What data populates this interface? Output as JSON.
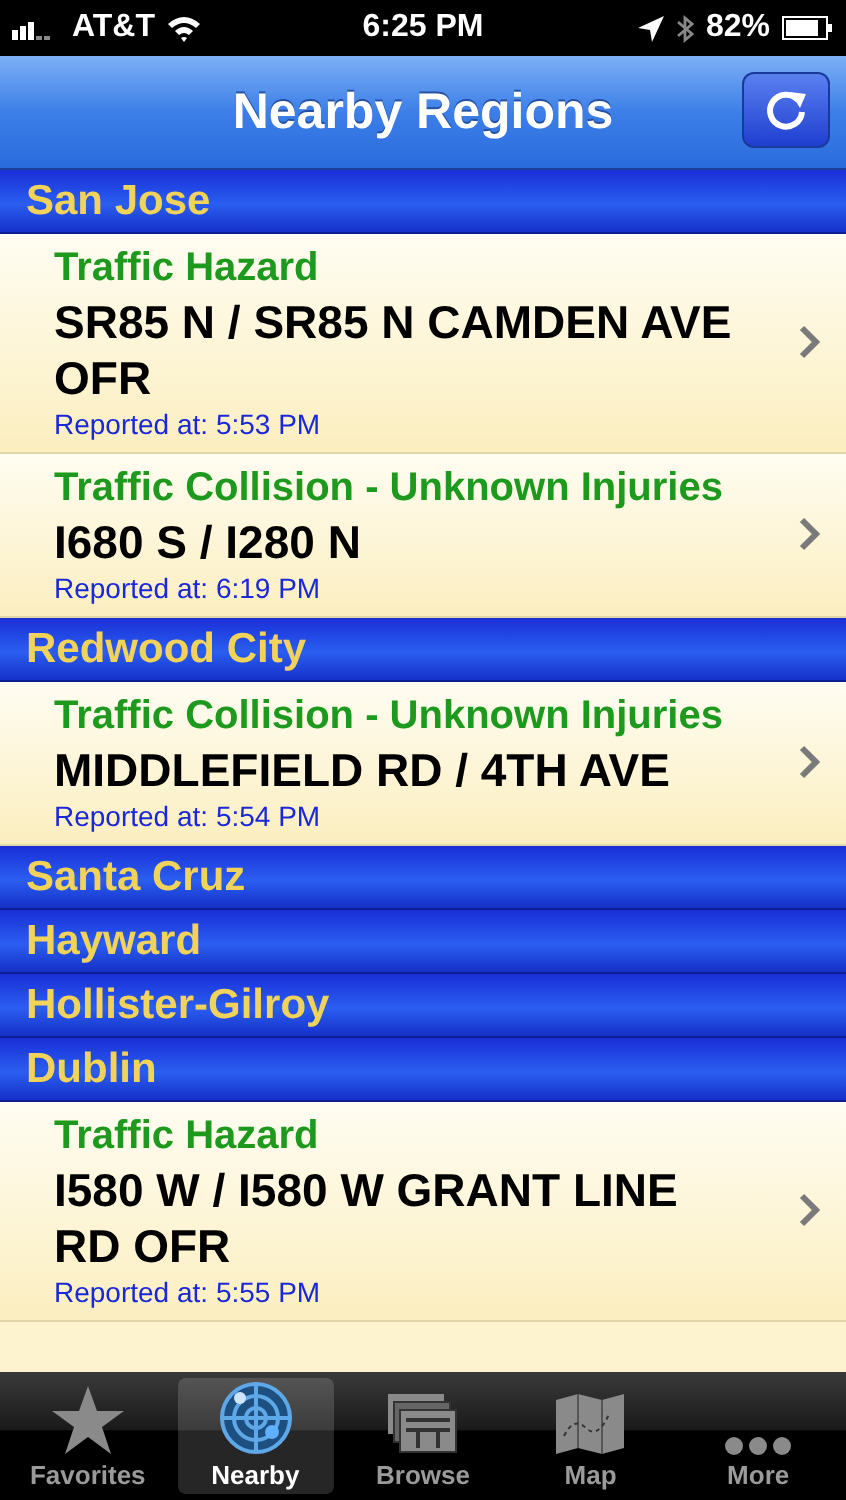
{
  "status_bar": {
    "carrier": "AT&T",
    "time": "6:25 PM",
    "battery": "82%"
  },
  "nav_bar": {
    "title": "Nearby Regions"
  },
  "regions": [
    {
      "name": "San Jose",
      "incidents": [
        {
          "type": "Traffic Hazard",
          "location": "SR85 N / SR85 N CAMDEN AVE OFR",
          "reported": "Reported at: 5:53 PM"
        },
        {
          "type": "Traffic Collision - Unknown Injuries",
          "location": "I680 S / I280 N",
          "reported": "Reported at: 6:19 PM"
        }
      ]
    },
    {
      "name": "Redwood City",
      "incidents": [
        {
          "type": "Traffic Collision - Unknown Injuries",
          "location": "MIDDLEFIELD RD / 4TH AVE",
          "reported": "Reported at: 5:54 PM"
        }
      ]
    },
    {
      "name": "Santa Cruz"
    },
    {
      "name": "Hayward"
    },
    {
      "name": "Hollister-Gilroy"
    },
    {
      "name": "Dublin",
      "incidents": [
        {
          "type": "Traffic Hazard",
          "location": "I580 W / I580 W GRANT LINE RD OFR",
          "reported": "Reported at: 5:55 PM"
        }
      ]
    }
  ],
  "tabs": [
    {
      "kind": "star",
      "label": "Favorites",
      "selected": false
    },
    {
      "kind": "radar",
      "label": "Nearby",
      "selected": true
    },
    {
      "kind": "cards",
      "label": "Browse",
      "selected": false
    },
    {
      "kind": "map",
      "label": "Map",
      "selected": false
    },
    {
      "kind": "dots",
      "label": "More",
      "selected": false
    }
  ]
}
